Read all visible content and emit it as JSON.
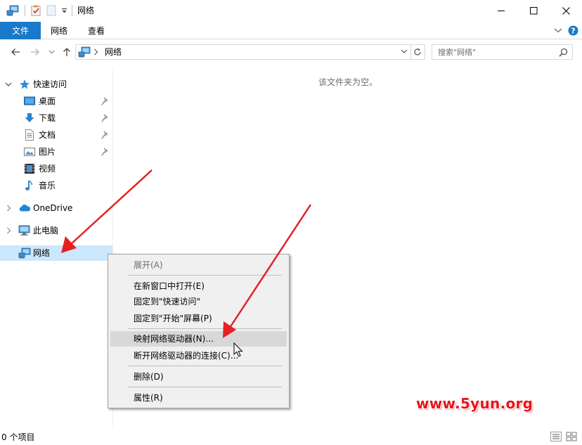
{
  "window": {
    "title": "网络",
    "quick_access_icons": [
      "network-icon",
      "properties-icon",
      "new-folder-icon",
      "customize-dropdown-icon"
    ],
    "controls": [
      "minimize-icon",
      "maximize-icon",
      "close-icon"
    ]
  },
  "ribbon": {
    "tabs": [
      {
        "label": "文件",
        "active": true
      },
      {
        "label": "网络"
      },
      {
        "label": "查看"
      }
    ],
    "right_icons": [
      "expand-ribbon-icon",
      "help-icon"
    ]
  },
  "navigation": {
    "back_icon": "back-arrow-icon",
    "forward_icon": "forward-arrow-icon",
    "recent_icon": "recent-dropdown-icon",
    "up_icon": "up-arrow-icon"
  },
  "address": {
    "path": [
      "网络"
    ]
  },
  "search": {
    "placeholder": "搜索\"网络\""
  },
  "sidebar": {
    "quick_access": {
      "label": "快速访问",
      "expanded": true
    },
    "pinned": [
      {
        "label": "桌面",
        "icon": "desktop-icon",
        "pinned": true
      },
      {
        "label": "下载",
        "icon": "download-icon",
        "pinned": true
      },
      {
        "label": "文档",
        "icon": "document-icon",
        "pinned": true
      },
      {
        "label": "图片",
        "icon": "picture-icon",
        "pinned": true
      },
      {
        "label": "视频",
        "icon": "video-icon",
        "pinned": false
      },
      {
        "label": "音乐",
        "icon": "music-icon",
        "pinned": false
      }
    ],
    "onedrive": {
      "label": "OneDrive"
    },
    "this_pc": {
      "label": "此电脑"
    },
    "network": {
      "label": "网络",
      "selected": true
    }
  },
  "content": {
    "empty_message": "该文件夹为空。"
  },
  "context_menu": {
    "items": [
      {
        "label": "展开(A)",
        "disabled": true
      },
      {
        "label": "在新窗口中打开(E)"
      },
      {
        "label": "固定到\"快速访问\""
      },
      {
        "label": "固定到\"开始\"屏幕(P)"
      },
      {
        "label": "映射网络驱动器(N)...",
        "highlighted": true
      },
      {
        "label": "断开网络驱动器的连接(C)..."
      },
      {
        "label": "删除(D)"
      },
      {
        "label": "属性(R)"
      }
    ]
  },
  "status": {
    "item_count": "0 个项目",
    "view_icons": [
      "details-view-icon",
      "large-icons-view-icon"
    ]
  },
  "watermark": {
    "text": "www.5yun.org"
  },
  "colors": {
    "accent": "#1979ca",
    "selection": "#cce8ff",
    "menu_bg": "#f0f0f0",
    "arrow": "#e52222",
    "help": "#1979ca"
  }
}
